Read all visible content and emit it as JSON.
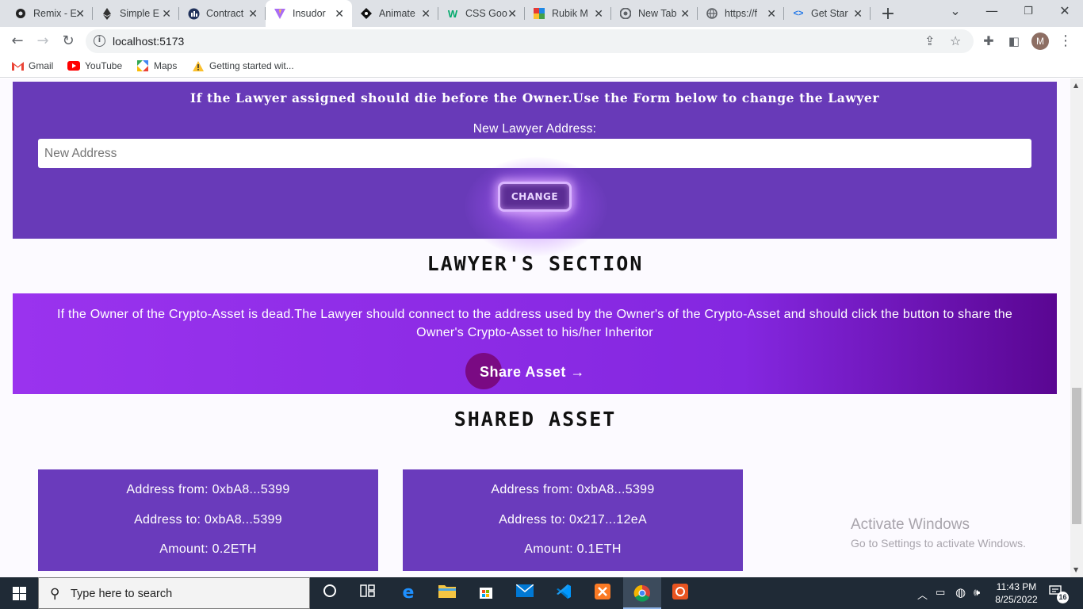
{
  "browser": {
    "tabs": [
      {
        "label": "Remix - E",
        "icon": "remix-icon"
      },
      {
        "label": "Simple E",
        "icon": "ethereum-icon"
      },
      {
        "label": "Contract",
        "icon": "contract-icon"
      },
      {
        "label": "Insudor",
        "icon": "vite-icon"
      },
      {
        "label": "Animate",
        "icon": "animate-icon"
      },
      {
        "label": "CSS Goo",
        "icon": "w3schools-icon"
      },
      {
        "label": "Rubik M",
        "icon": "rubik-icon"
      },
      {
        "label": "New Tab",
        "icon": "chrome-icon"
      },
      {
        "label": "https://f",
        "icon": "globe-icon"
      },
      {
        "label": "Get Star",
        "icon": "code-icon"
      }
    ],
    "url": "localhost:5173",
    "profile_initial": "M",
    "bookmarks": [
      {
        "label": "Gmail",
        "icon": "gmail-icon"
      },
      {
        "label": "YouTube",
        "icon": "youtube-icon"
      },
      {
        "label": "Maps",
        "icon": "maps-icon"
      },
      {
        "label": "Getting started wit...",
        "icon": "warning-icon"
      }
    ]
  },
  "change_lawyer": {
    "title": "If the Lawyer assigned should die before the Owner.Use the Form below to change the Lawyer",
    "field_label": "New Lawyer Address:",
    "input_placeholder": "New Address",
    "button_label": "CHANGE"
  },
  "lawyer_section": {
    "heading": "LAWYER'S SECTION",
    "instructions": "If the Owner of the Crypto-Asset is dead.The Lawyer should connect to the address used by the Owner's of the Crypto-Asset and should click the button to share the Owner's Crypto-Asset to his/her Inheritor",
    "share_button": "Share Asset →"
  },
  "shared_asset": {
    "heading": "SHARED ASSET",
    "cards": [
      {
        "from": "Address from: 0xbA8...5399",
        "to": "Address to: 0xbA8...5399",
        "amount": "Amount: 0.2ETH"
      },
      {
        "from": "Address from: 0xbA8...5399",
        "to": "Address to: 0x217...12eA",
        "amount": "Amount: 0.1ETH"
      }
    ]
  },
  "watermark": {
    "line1": "Activate Windows",
    "line2": "Go to Settings to activate Windows."
  },
  "taskbar": {
    "search_placeholder": "Type here to search",
    "time": "11:43 PM",
    "date": "8/25/2022",
    "notification_count": "16"
  },
  "colors": {
    "panel_purple": "#683ab8",
    "banner_purple": "#8427e0",
    "card_purple": "#6a3bbc",
    "taskbar": "#1f2a36"
  }
}
